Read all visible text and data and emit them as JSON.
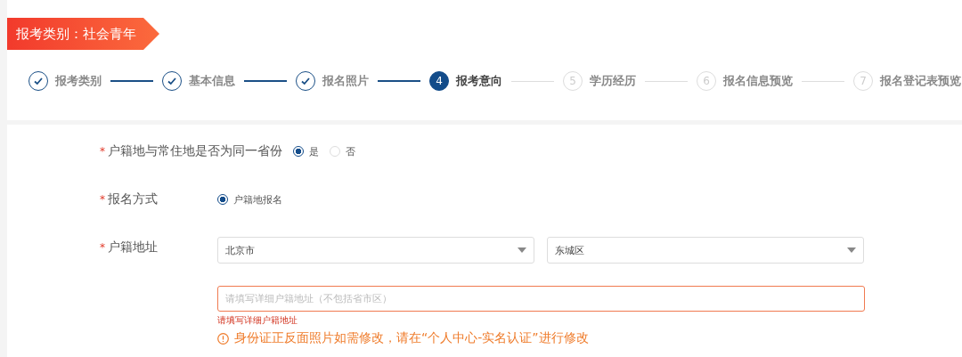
{
  "category_banner": "报考类别：社会青年",
  "steps": [
    {
      "label": "报考类别",
      "completed": true,
      "selected": false
    },
    {
      "label": "基本信息",
      "completed": true,
      "selected": false
    },
    {
      "label": "报名照片",
      "completed": true,
      "selected": false
    },
    {
      "number": "4",
      "label": "报考意向",
      "completed": false,
      "selected": true
    },
    {
      "number": "5",
      "label": "学历经历",
      "completed": false,
      "selected": false
    },
    {
      "number": "6",
      "label": "报名信息预览",
      "completed": false,
      "selected": false
    },
    {
      "number": "7",
      "label": "报名登记表预览",
      "completed": false,
      "selected": false
    }
  ],
  "form": [
    {
      "kind": "radio",
      "marker": "*",
      "label": "户籍地与常住地是否为同一省份",
      "options": [
        {
          "label": "是",
          "selected": true
        },
        {
          "label": "否",
          "selected": false
        }
      ]
    },
    {
      "kind": "radio",
      "marker": "*",
      "label": "报名方式",
      "options": [
        {
          "label": "户籍地报名",
          "selected": true
        }
      ]
    },
    {
      "kind": "address",
      "marker": "*",
      "label": "户籍地址",
      "selects": [
        "北京市",
        "东城区"
      ],
      "detail": {
        "placeholder": "请填写详细户籍地址（不包括省市区）",
        "error": "请填写详细户籍地址"
      }
    }
  ],
  "notice": "身份证正反面照片如需修改，请在“个人中心-实名认证”进行修改"
}
